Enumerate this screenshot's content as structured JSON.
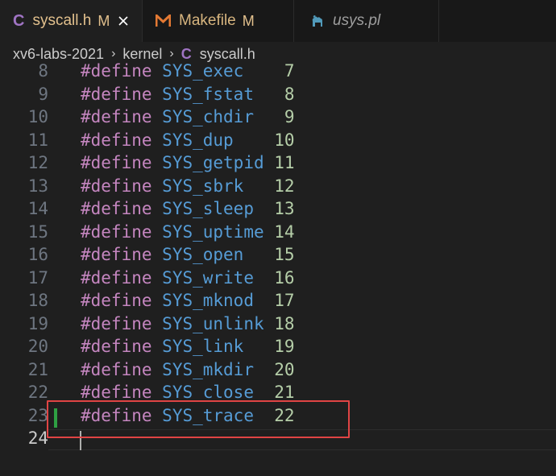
{
  "tabs": [
    {
      "label": "syscall.h",
      "status": "M",
      "icon": "c-file-icon",
      "active": true
    },
    {
      "label": "Makefile",
      "status": "M",
      "icon": "makefile-icon",
      "active": false
    },
    {
      "label": "usys.pl",
      "status": "",
      "icon": "perl-camel-icon",
      "active": false
    }
  ],
  "breadcrumb": {
    "folder1": "xv6-labs-2021",
    "folder2": "kernel",
    "file": "syscall.h",
    "file_icon_letter": "C"
  },
  "tab_icon_letter": "C",
  "editor": {
    "lines": [
      {
        "num": "8",
        "kw": "#define",
        "macro": "SYS_exec",
        "pad": "    ",
        "value": "7"
      },
      {
        "num": "9",
        "kw": "#define",
        "macro": "SYS_fstat",
        "pad": "   ",
        "value": "8"
      },
      {
        "num": "10",
        "kw": "#define",
        "macro": "SYS_chdir",
        "pad": "   ",
        "value": "9"
      },
      {
        "num": "11",
        "kw": "#define",
        "macro": "SYS_dup",
        "pad": "    ",
        "value": "10"
      },
      {
        "num": "12",
        "kw": "#define",
        "macro": "SYS_getpid",
        "pad": " ",
        "value": "11"
      },
      {
        "num": "13",
        "kw": "#define",
        "macro": "SYS_sbrk",
        "pad": "   ",
        "value": "12"
      },
      {
        "num": "14",
        "kw": "#define",
        "macro": "SYS_sleep",
        "pad": "  ",
        "value": "13"
      },
      {
        "num": "15",
        "kw": "#define",
        "macro": "SYS_uptime",
        "pad": " ",
        "value": "14"
      },
      {
        "num": "16",
        "kw": "#define",
        "macro": "SYS_open",
        "pad": "   ",
        "value": "15"
      },
      {
        "num": "17",
        "kw": "#define",
        "macro": "SYS_write",
        "pad": "  ",
        "value": "16"
      },
      {
        "num": "18",
        "kw": "#define",
        "macro": "SYS_mknod",
        "pad": "  ",
        "value": "17"
      },
      {
        "num": "19",
        "kw": "#define",
        "macro": "SYS_unlink",
        "pad": " ",
        "value": "18"
      },
      {
        "num": "20",
        "kw": "#define",
        "macro": "SYS_link",
        "pad": "   ",
        "value": "19"
      },
      {
        "num": "21",
        "kw": "#define",
        "macro": "SYS_mkdir",
        "pad": "  ",
        "value": "20"
      },
      {
        "num": "22",
        "kw": "#define",
        "macro": "SYS_close",
        "pad": "  ",
        "value": "21"
      },
      {
        "num": "23",
        "kw": "#define",
        "macro": "SYS_trace",
        "pad": "  ",
        "value": "22"
      },
      {
        "num": "24",
        "kw": "",
        "macro": "",
        "pad": "",
        "value": ""
      }
    ],
    "current_line": "24",
    "added_line": "23"
  },
  "colors": {
    "keyword": "#c586c0",
    "macro": "#569cd6",
    "number": "#b5cea8",
    "highlight_border": "#e04444",
    "git_added": "#2ea043"
  }
}
